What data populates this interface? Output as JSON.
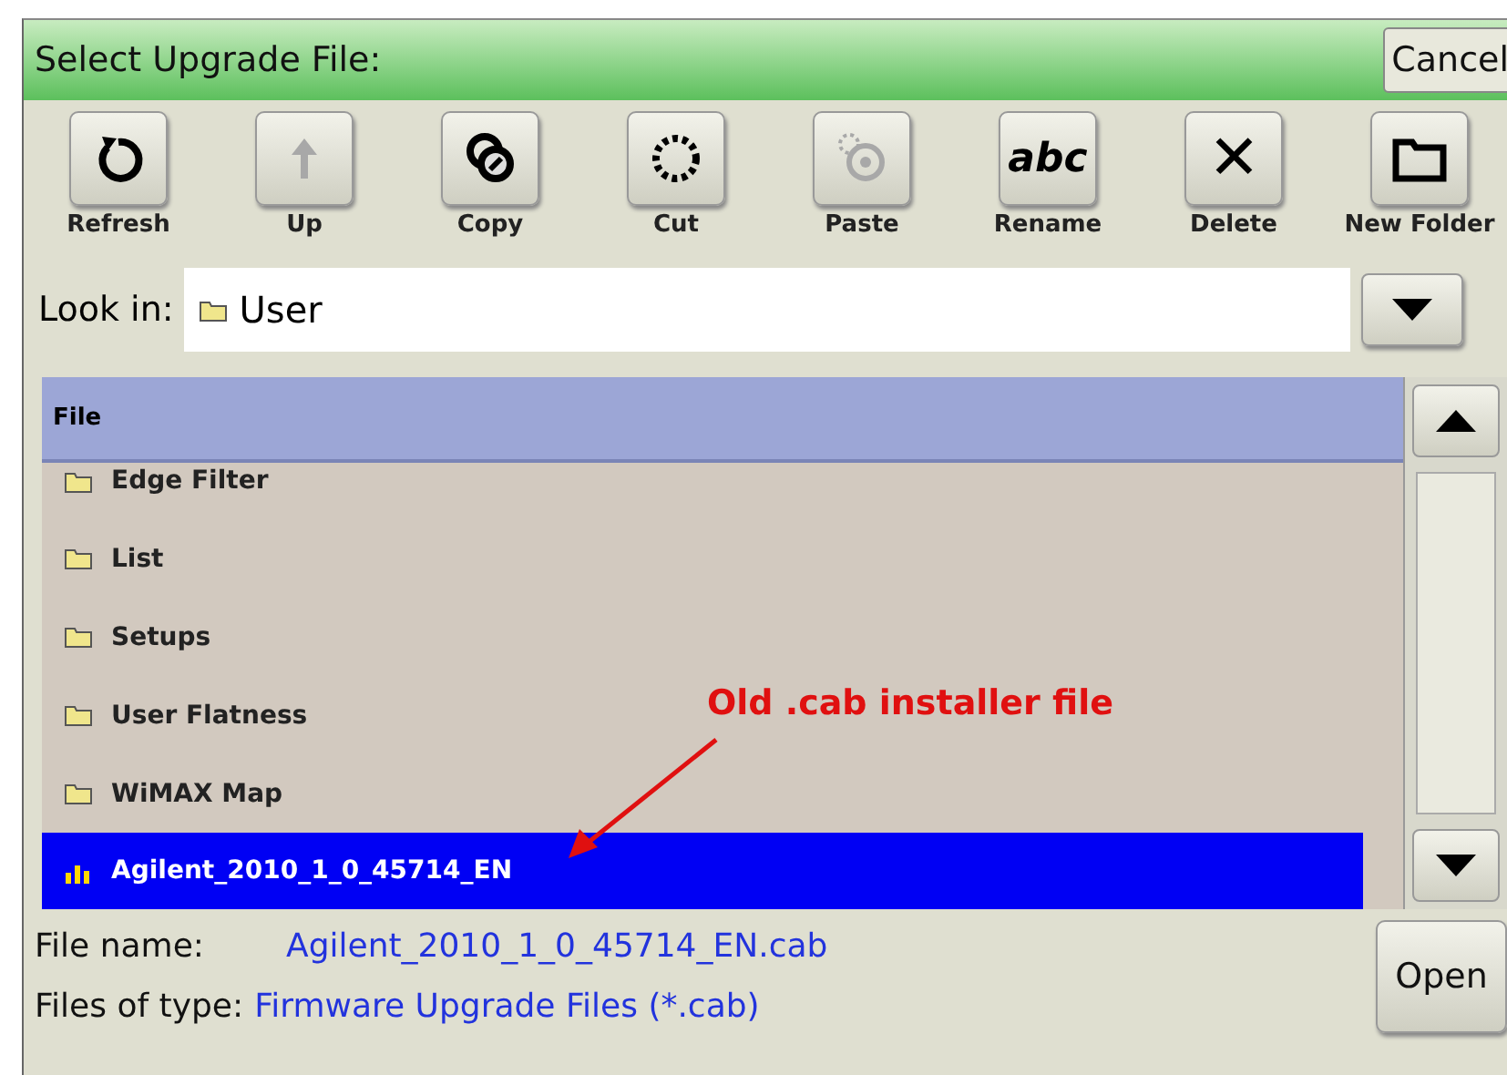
{
  "window": {
    "title": "Select Upgrade File:",
    "cancel": "Cancel"
  },
  "toolbar": [
    {
      "label": "Refresh",
      "disabled": false
    },
    {
      "label": "Up",
      "disabled": true
    },
    {
      "label": "Copy",
      "disabled": false
    },
    {
      "label": "Cut",
      "disabled": false
    },
    {
      "label": "Paste",
      "disabled": true
    },
    {
      "label": "Rename",
      "disabled": false,
      "glyph": "abc"
    },
    {
      "label": "Delete",
      "disabled": false,
      "glyph": "✕"
    },
    {
      "label": "New Folder",
      "disabled": false
    }
  ],
  "look_in": {
    "label": "Look in:",
    "value": "User"
  },
  "file_list": {
    "header": "File",
    "rows": [
      {
        "name": "Edge Filter",
        "kind": "folder",
        "selected": false
      },
      {
        "name": "List",
        "kind": "folder",
        "selected": false
      },
      {
        "name": "Setups",
        "kind": "folder",
        "selected": false
      },
      {
        "name": "User Flatness",
        "kind": "folder",
        "selected": false
      },
      {
        "name": "WiMAX Map",
        "kind": "folder",
        "selected": false
      },
      {
        "name": "Agilent_2010_1_0_45714_EN",
        "kind": "file",
        "selected": true
      }
    ]
  },
  "annotation": {
    "text": "Old .cab installer file"
  },
  "file_name": {
    "label": "File name:",
    "value": "Agilent_2010_1_0_45714_EN.cab"
  },
  "file_type": {
    "label": "Files of type:",
    "value": "Firmware Upgrade Files (*.cab)"
  },
  "open_button": "Open"
}
